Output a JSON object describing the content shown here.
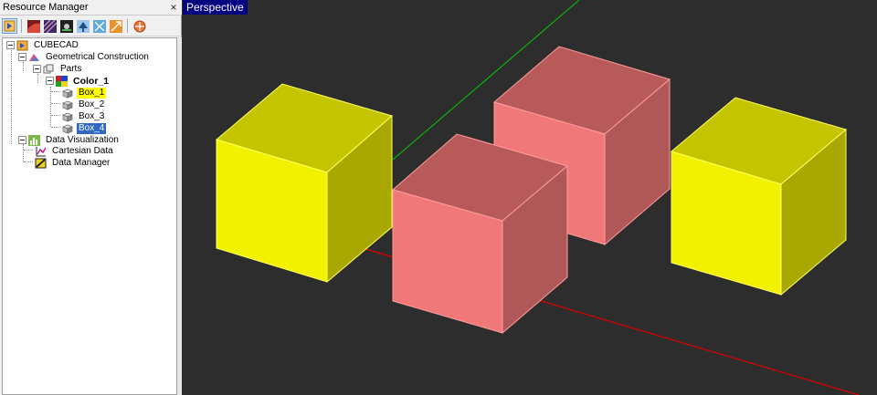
{
  "panel": {
    "title": "Resource Manager",
    "close_glyph": "×"
  },
  "toolbar": {
    "buttons": [
      {
        "icon": "exit-icon"
      },
      {
        "icon": "surface-icon"
      },
      {
        "icon": "mesh-icon"
      },
      {
        "icon": "material-icon"
      },
      {
        "icon": "tree-icon"
      },
      {
        "icon": "network-icon"
      },
      {
        "icon": "transform-icon"
      },
      {
        "icon": "target-icon"
      }
    ]
  },
  "tree": {
    "root": "CUBECAD",
    "geometrical_construction": "Geometrical Construction",
    "parts": "Parts",
    "color_1": "Color_1",
    "box_1": "Box_1",
    "box_2": "Box_2",
    "box_3": "Box_3",
    "box_4": "Box_4",
    "data_visualization": "Data Visualization",
    "cartesian_data": "Cartesian Data",
    "data_manager": "Data Manager"
  },
  "viewport": {
    "mode_label": "Perspective",
    "background_color": "#2d2d2d",
    "colors": {
      "yellow_front": "#f2f200",
      "yellow_side": "#a8a800",
      "yellow_top": "#c4c400",
      "yellow_edge": "#ffff60",
      "pink_front": "#f07878",
      "pink_side": "#b05858",
      "pink_top": "#b85a5a",
      "pink_edge": "#ff9c9c",
      "axis_red": "#e00000",
      "axis_green": "#00cc00"
    }
  }
}
